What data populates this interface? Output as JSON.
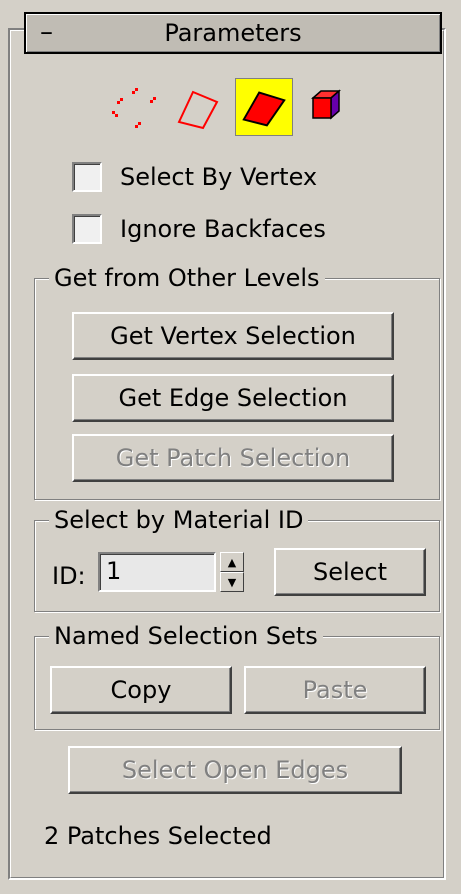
{
  "rollout": {
    "title": "Parameters",
    "collapse_glyph": "–"
  },
  "subobject_levels": [
    {
      "name": "vertex-level-icon",
      "active": false
    },
    {
      "name": "edge-level-icon",
      "active": false
    },
    {
      "name": "patch-level-icon",
      "active": true
    },
    {
      "name": "element-level-icon",
      "active": false
    }
  ],
  "options": {
    "select_by_vertex": {
      "label": "Select By Vertex",
      "checked": false
    },
    "ignore_backfaces": {
      "label": "Ignore Backfaces",
      "checked": false
    }
  },
  "get_from_other_levels": {
    "title": "Get from Other Levels",
    "vertex_button": "Get Vertex Selection",
    "edge_button": "Get Edge Selection",
    "patch_button": "Get Patch Selection"
  },
  "material_id": {
    "title": "Select by Material ID",
    "id_label": "ID:",
    "id_value": "1",
    "select_button": "Select"
  },
  "named_sets": {
    "title": "Named Selection Sets",
    "copy_button": "Copy",
    "paste_button": "Paste"
  },
  "select_open_edges_button": "Select Open Edges",
  "status": "2 Patches Selected",
  "colors": {
    "active_level_bg": "#ffff00",
    "icon_red": "#ff0000",
    "element_purple": "#6600aa"
  }
}
